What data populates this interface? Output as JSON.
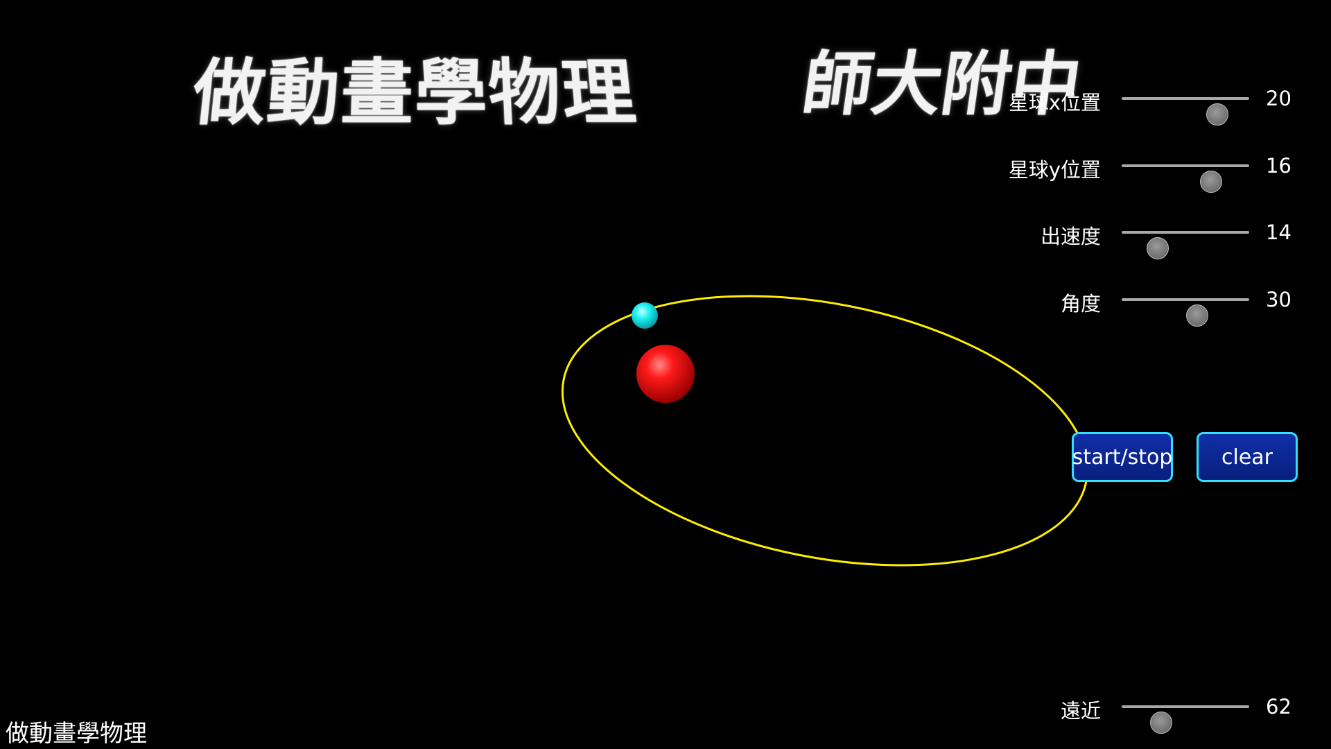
{
  "banner": {
    "left_text": "做動畫學物理",
    "right_text": "師大附中"
  },
  "sliders": [
    {
      "label": "星球x位置",
      "value": "20",
      "fraction": 0.75
    },
    {
      "label": "星球y位置",
      "value": "16",
      "fraction": 0.7
    },
    {
      "label": "出速度",
      "value": "14",
      "fraction": 0.28
    },
    {
      "label": "角度",
      "value": "30",
      "fraction": 0.59
    },
    {
      "label": "遠近",
      "value": "62",
      "fraction": 0.31
    }
  ],
  "buttons": {
    "start_stop": "start/stop",
    "clear": "clear"
  },
  "footer": {
    "label": "做動畫學物理"
  },
  "colors": {
    "background": "#000000",
    "orbit": "#ffee00",
    "star": "#ff1a1a",
    "planet": "#19f0f0",
    "button_fill": "#0a2590",
    "button_border": "#2fe0ff"
  }
}
